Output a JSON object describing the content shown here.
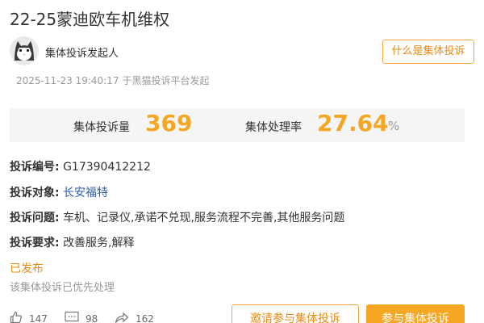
{
  "title": "22-25蒙迪欧车机维权",
  "initiator": {
    "avatar_icon": "cat-avatar-icon",
    "label": "集体投诉发起人"
  },
  "whatis_button": "什么是集体投诉",
  "meta": {
    "datetime": "2025-11-23 19:40:17",
    "source": "于黑猫投诉平台发起"
  },
  "stats": {
    "count_label": "集体投诉量",
    "count_value": "369",
    "rate_label": "集体处理率",
    "rate_value": "27.64",
    "rate_unit": "%"
  },
  "info": {
    "id_key": "投诉编号:",
    "id_value": "G17390412212",
    "target_key": "投诉对象:",
    "target_value": "长安福特",
    "issue_key": "投诉问题:",
    "issue_value": "车机、记录仪,承诺不兑现,服务流程不完善,其他服务问题",
    "demand_key": "投诉要求:",
    "demand_value": "改善服务,解释"
  },
  "status": {
    "label": "已发布",
    "desc": "该集体投诉已优先处理"
  },
  "actions": {
    "likes": "147",
    "comments": "98",
    "shares": "162"
  },
  "buttons": {
    "invite": "邀请参与集体投诉",
    "join": "参与集体投诉"
  },
  "colors": {
    "accent": "#f5a623",
    "accent_text": "#e88b12",
    "link": "#2f5ea8",
    "muted": "#999999"
  }
}
